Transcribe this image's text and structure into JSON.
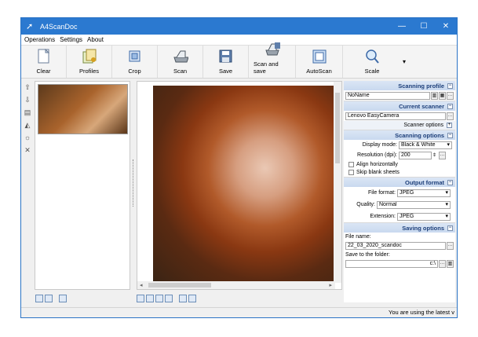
{
  "window": {
    "title": "A4ScanDoc",
    "minimize": "—",
    "maximize": "☐",
    "close": "✕"
  },
  "menu": [
    "Operations",
    "Settings",
    "About"
  ],
  "toolbar": [
    {
      "label": "Clear",
      "icon": "page-icon"
    },
    {
      "label": "Profiles",
      "icon": "profiles-icon"
    },
    {
      "label": "Crop",
      "icon": "crop-icon"
    },
    {
      "label": "Scan",
      "icon": "scanner-icon"
    },
    {
      "label": "Save",
      "icon": "save-icon"
    },
    {
      "label": "Scan and save",
      "icon": "scan-save-icon"
    },
    {
      "label": "AutoScan",
      "icon": "autoscan-icon"
    },
    {
      "label": "Scale",
      "icon": "magnifier-icon"
    }
  ],
  "panel": {
    "profile": {
      "title": "Scanning profile",
      "value": "NoName"
    },
    "scanner": {
      "title": "Current scanner",
      "value": "Lenovo EasyCamera",
      "options": "Scanner options"
    },
    "options": {
      "title": "Scanning options",
      "display_mode_label": "Display mode:",
      "display_mode": "Black & White",
      "resolution_label": "Resolution (dpi):",
      "resolution": "200",
      "align": "Align horizontally",
      "skip": "Skip blank sheets"
    },
    "output": {
      "title": "Output format",
      "format_label": "File format:",
      "format": "JPEG",
      "quality_label": "Quality:",
      "quality": "Normal",
      "ext_label": "Extension:",
      "ext": "JPEG"
    },
    "saving": {
      "title": "Saving options",
      "filename_label": "File name:",
      "filename": "22_03_2020_scandoc",
      "folder_label": "Save to the folder:",
      "folder": "c:\\"
    }
  },
  "status": "You are using the latest v"
}
